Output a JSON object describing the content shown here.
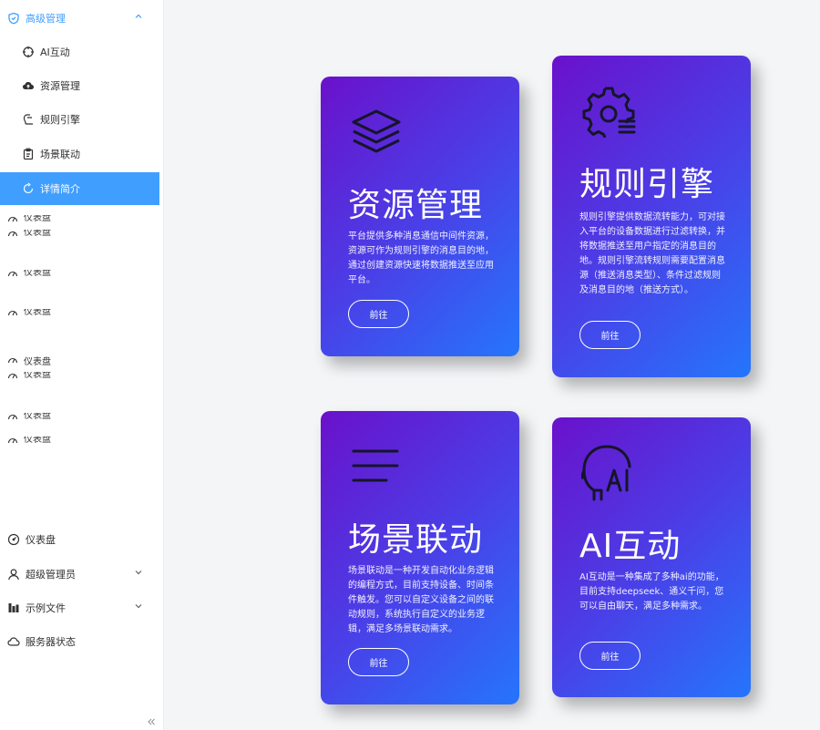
{
  "sidebar": {
    "group": {
      "label": "高级管理",
      "icon": "shield-icon"
    },
    "sub_items": [
      {
        "label": "AI互动",
        "icon": "crosshair-icon"
      },
      {
        "label": "资源管理",
        "icon": "cloud-upload-icon"
      },
      {
        "label": "规则引擎",
        "icon": "rule-icon"
      },
      {
        "label": "场景联动",
        "icon": "clipboard-icon"
      },
      {
        "label": "详情简介",
        "icon": "refresh-icon",
        "active": true
      }
    ],
    "glitch_label": "仪表盘",
    "top_items": [
      {
        "label": "仪表盘",
        "icon": "dashboard-icon"
      },
      {
        "label": "超级管理员",
        "icon": "user-icon"
      },
      {
        "label": "示例文件",
        "icon": "chart-icon"
      },
      {
        "label": "服务器状态",
        "icon": "cloud-icon"
      }
    ]
  },
  "cards": [
    {
      "icon": "layers-icon",
      "title": "资源管理",
      "description": "平台提供多种消息通信中间件资源，资源可作为规则引擎的消息目的地，通过创建资源快速将数据推送至应用平台。",
      "button": "前往"
    },
    {
      "icon": "gear-list-icon",
      "title": "规则引擎",
      "description": "规则引擎提供数据流转能力，可对接入平台的设备数据进行过滤转换，并将数据推送至用户指定的消息目的地。规则引擎流转规则需要配置消息源（推送消息类型）、条件过滤规则及消息目的地（推送方式）。",
      "button": "前往"
    },
    {
      "icon": "menu-lines-icon",
      "title": "场景联动",
      "description": "场景联动是一种开发自动化业务逻辑的编程方式，目前支持设备、时间条件触发。您可以自定义设备之间的联动规则，系统执行自定义的业务逻辑，满足多场景联动需求。",
      "button": "前往"
    },
    {
      "icon": "ai-head-icon",
      "title": "AI互动",
      "description": "AI互动是一种集成了多种ai的功能，目前支持deepseek、通义千问，您可以自由聊天，满足多种需求。",
      "button": "前往"
    }
  ]
}
